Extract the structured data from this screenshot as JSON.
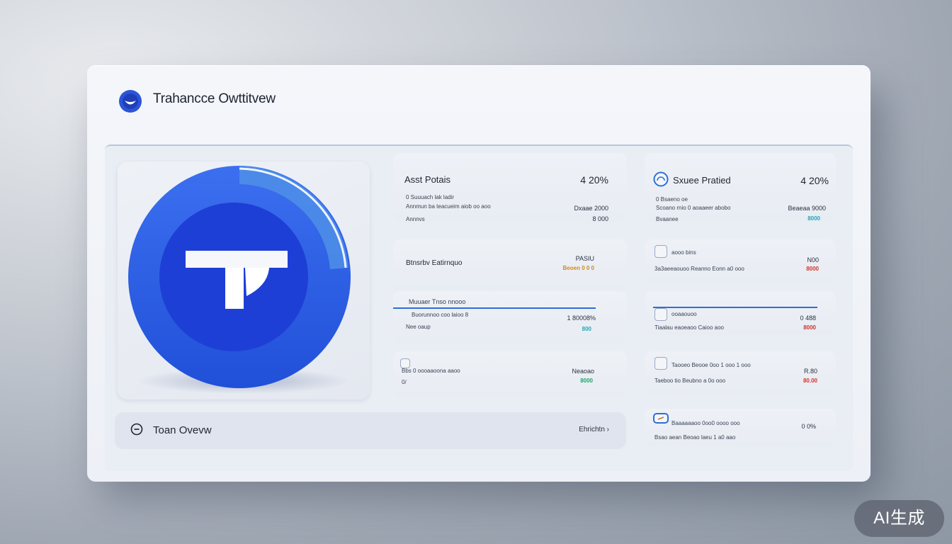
{
  "app": {
    "title": "Trahancce Owttitvew",
    "accent_color": "#2b55d8",
    "logo_icon": "blue-circle-logo"
  },
  "hero": {
    "logo_letter": "T"
  },
  "overview_bar": {
    "label": "Toan Ovevw",
    "link_label": "Ehrichtn ›",
    "icon": "circle-minus-icon"
  },
  "left_column": {
    "asset_tile": {
      "title": "Asst Potais",
      "value": "4 20%",
      "line1": "0 Suuuach lak ladir",
      "line2": "Annmun ba teacueim aiob oo aoo",
      "line3": "Annnvs",
      "num1": "Dxaae 2000",
      "num2": "8 000"
    },
    "balance_tile": {
      "title": "Btnsrbv Eatirnquo",
      "num1": "PASIU",
      "num2": "Beoen 0 0 0"
    },
    "market_tile": {
      "title": "Muuaer Tnso nnooo",
      "line1": "Buorunnoo coo laioo 8",
      "line2": "Nee oaup",
      "num1": "1 80008%",
      "num2": "800"
    },
    "small_tile": {
      "line1": "Bbs 0 oooaaoona aaoo",
      "line2": "0/",
      "num1": "Neaoao",
      "num2": "8000"
    }
  },
  "right_column": {
    "score_tile": {
      "title": "Sxuee Pratied",
      "value": "4 20%",
      "line1": "0 Bsaeno oe",
      "line2": "Scoano rnio 0 aoaaeer abobo",
      "line3": "Bvaanee",
      "num1": "Beaeaa 9000",
      "num2": "8000"
    },
    "tile2": {
      "line1": "aooo bins",
      "line2": "3a3aeeaouoo Reanno Eonn a0 ooo",
      "num1": "N00",
      "num2": "8000"
    },
    "tile3": {
      "line1": "ooaaouoo",
      "line2": "Tiaalau eaoeaoo Caioo aoo",
      "num1": "0 488",
      "num2": "8000"
    },
    "tile4": {
      "line1": "Taooeo Beooe  0oo 1 ooo 1 ooo",
      "line2": "Taeboo tio Beubno a 0o ooo",
      "num1": "R.80",
      "num2": "80.00"
    },
    "tile5": {
      "line1": "Baaaaaaoo 0oo0 oooo ooo",
      "line2": "Bsao aean Beoao laeu 1 a0 aao",
      "num1": "0 0%"
    }
  },
  "watermark": {
    "label": "AI生成"
  }
}
